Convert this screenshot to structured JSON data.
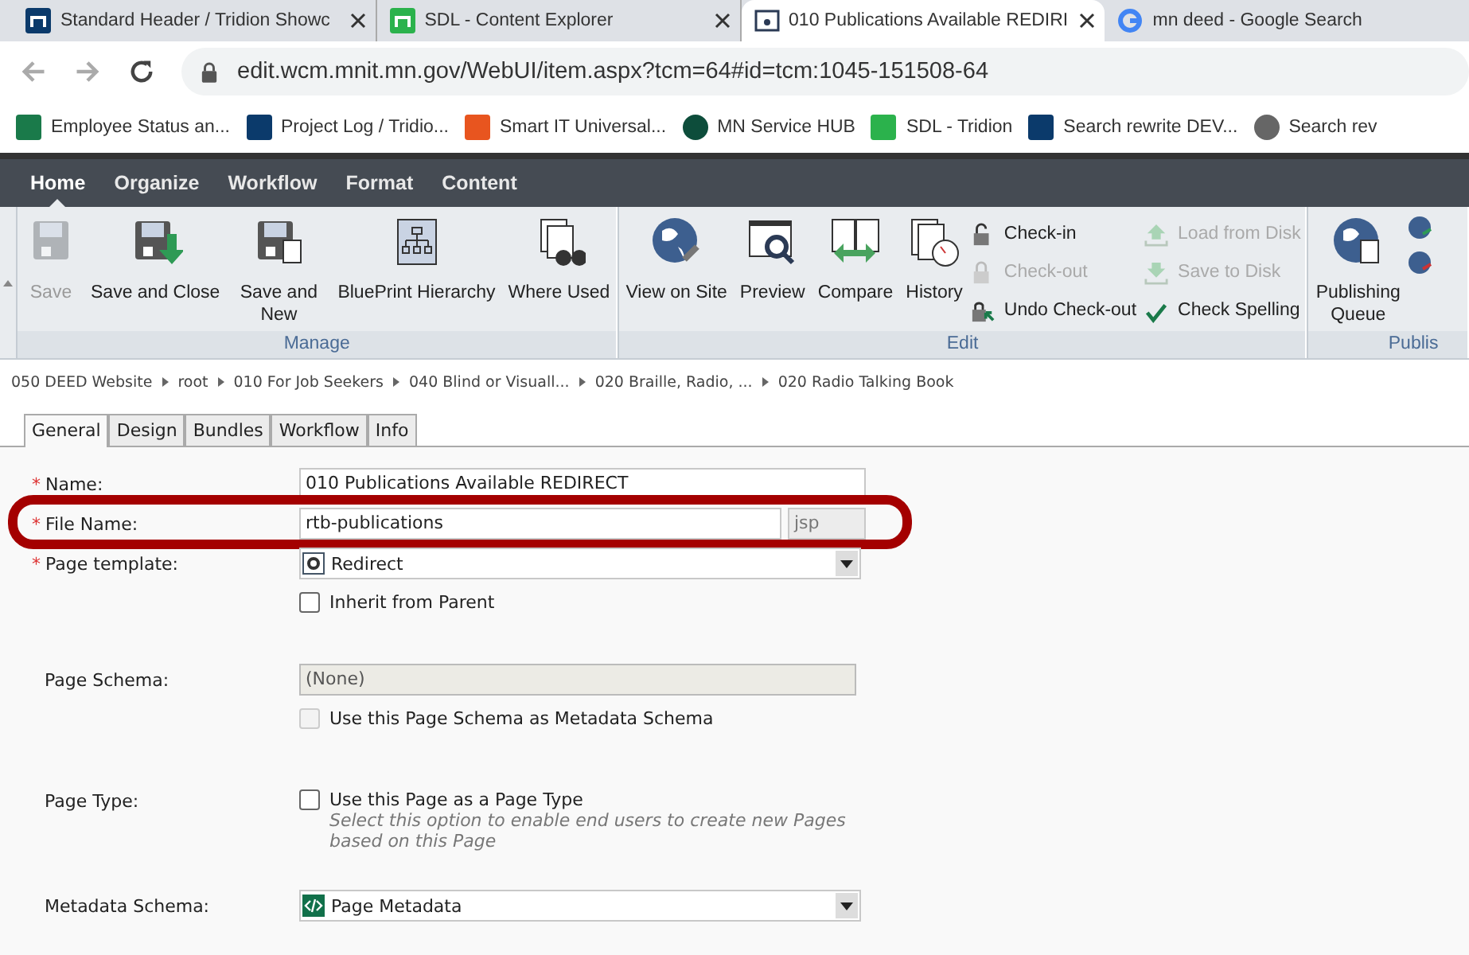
{
  "browser": {
    "tabs": [
      {
        "title": "Standard Header / Tridion Showc",
        "selected": false
      },
      {
        "title": "SDL - Content Explorer",
        "selected": false
      },
      {
        "title": "010 Publications Available REDIRI",
        "selected": true
      },
      {
        "title": "mn deed - Google Search",
        "selected": false
      }
    ],
    "url": "edit.wcm.mnit.mn.gov/WebUI/item.aspx?tcm=64#id=tcm:1045-151508-64",
    "bookmarks": [
      "Employee Status an...",
      "Project Log / Tridio...",
      "Smart IT Universal...",
      "MN Service HUB",
      "SDL - Tridion",
      "Search rewrite DEV...",
      "Search rev"
    ]
  },
  "ribbon": {
    "tabs": [
      {
        "label": "Home",
        "selected": true
      },
      {
        "label": "Organize",
        "selected": false
      },
      {
        "label": "Workflow",
        "selected": false
      },
      {
        "label": "Format",
        "selected": false
      },
      {
        "label": "Content",
        "selected": false
      }
    ],
    "groups": [
      {
        "label": "Manage",
        "large": [
          {
            "label": "Save",
            "disabled": true
          },
          {
            "label": "Save and Close",
            "disabled": false
          },
          {
            "label": "Save and New",
            "disabled": false
          },
          {
            "label": "BluePrint Hierarchy",
            "disabled": false
          },
          {
            "label": "Where Used",
            "disabled": false
          }
        ]
      },
      {
        "label": "Edit",
        "large": [
          {
            "label": "View on Site",
            "disabled": false
          },
          {
            "label": "Preview",
            "disabled": false
          },
          {
            "label": "Compare",
            "disabled": false
          },
          {
            "label": "History",
            "disabled": false
          }
        ],
        "small": [
          {
            "label": "Check-in",
            "disabled": false
          },
          {
            "label": "Check-out",
            "disabled": true
          },
          {
            "label": "Undo Check-out",
            "disabled": false
          },
          {
            "label": "Load from Disk",
            "disabled": true
          },
          {
            "label": "Save to Disk",
            "disabled": true
          },
          {
            "label": "Check Spelling",
            "disabled": false
          }
        ]
      },
      {
        "label": "Publis",
        "large": [
          {
            "label": "Publishing Queue",
            "disabled": false
          }
        ]
      }
    ]
  },
  "breadcrumb": [
    "050 DEED Website",
    "root",
    "010 For Job Seekers",
    "040 Blind or Visuall...",
    "020 Braille, Radio, ...",
    "020 Radio Talking Book"
  ],
  "form": {
    "tabs": [
      {
        "label": "General",
        "selected": true
      },
      {
        "label": "Design",
        "selected": false
      },
      {
        "label": "Bundles",
        "selected": false
      },
      {
        "label": "Workflow",
        "selected": false
      },
      {
        "label": "Info",
        "selected": false
      }
    ],
    "sections": [
      [
        {
          "label": "Name:",
          "required_mark": "*",
          "kind": "text",
          "value": "010 Publications Available REDIRECT"
        },
        {
          "label": "File Name:",
          "required_mark": "*",
          "kind": "filename",
          "value": "rtb-publications",
          "extension": "jsp",
          "highlighted": true
        },
        {
          "label": "Page template:",
          "required_mark": "*",
          "kind": "dropdown",
          "value": "Redirect"
        },
        {
          "kind": "checkbox",
          "option": "Inherit from Parent",
          "checked": false,
          "disabled": false
        }
      ],
      [
        {
          "label": "Page Schema:",
          "kind": "readonly",
          "value": "(None)"
        },
        {
          "kind": "checkbox",
          "option": "Use this Page Schema as Metadata Schema",
          "checked": false,
          "disabled": true
        }
      ],
      [
        {
          "label": "Page Type:",
          "kind": "checkbox",
          "option": "Use this Page as a Page Type",
          "hint": "Select this option to enable end users to create new Pages based on this Page",
          "checked": false,
          "disabled": false
        }
      ],
      [
        {
          "label": "Metadata Schema:",
          "kind": "dropdown",
          "value": "Page Metadata"
        }
      ]
    ]
  }
}
